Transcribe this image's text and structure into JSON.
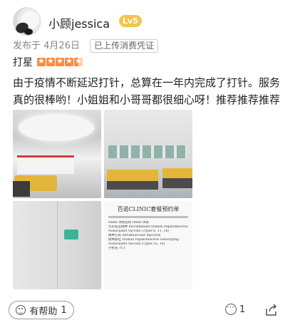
{
  "user": {
    "name": "小顾jessica",
    "level": "Lv5"
  },
  "meta": {
    "date": "发布于 4月26日",
    "voucher": "已上传消费凭证"
  },
  "rating": {
    "label": "打星",
    "stars": 4.5,
    "max": 5,
    "color": "#ff8a3d"
  },
  "review": {
    "text": "由于疫情不断延迟打针，总算在一年内完成了打针。服务真的很棒哟！小姐姐和小哥哥都很细心呀！推荐推荐推荐"
  },
  "photos": [
    {
      "name": "reception-desk-photo"
    },
    {
      "name": "waiting-area-photo"
    },
    {
      "name": "hallway-sign-photo"
    },
    {
      "name": "vaccine-record-photo"
    }
  ],
  "document": {
    "title": "百诺CLINIC套餐预约单",
    "rows": [
      "Items  项目名称  Items 项目",
      "九价疫苗接种  Recombinant Human Papillomavirus",
      "Nonavalent Vaccine (Types 6, 11, 16)",
      "接种方式  Intramuscular Injection",
      "接种部位  Human Papillomavirus Genotyping",
      "Nonavalent Vaccine (Types 16, 18)",
      "学校名  TCT"
    ]
  },
  "footer": {
    "helpful_label": "有帮助",
    "helpful_count": "1",
    "comment_count": "1"
  }
}
